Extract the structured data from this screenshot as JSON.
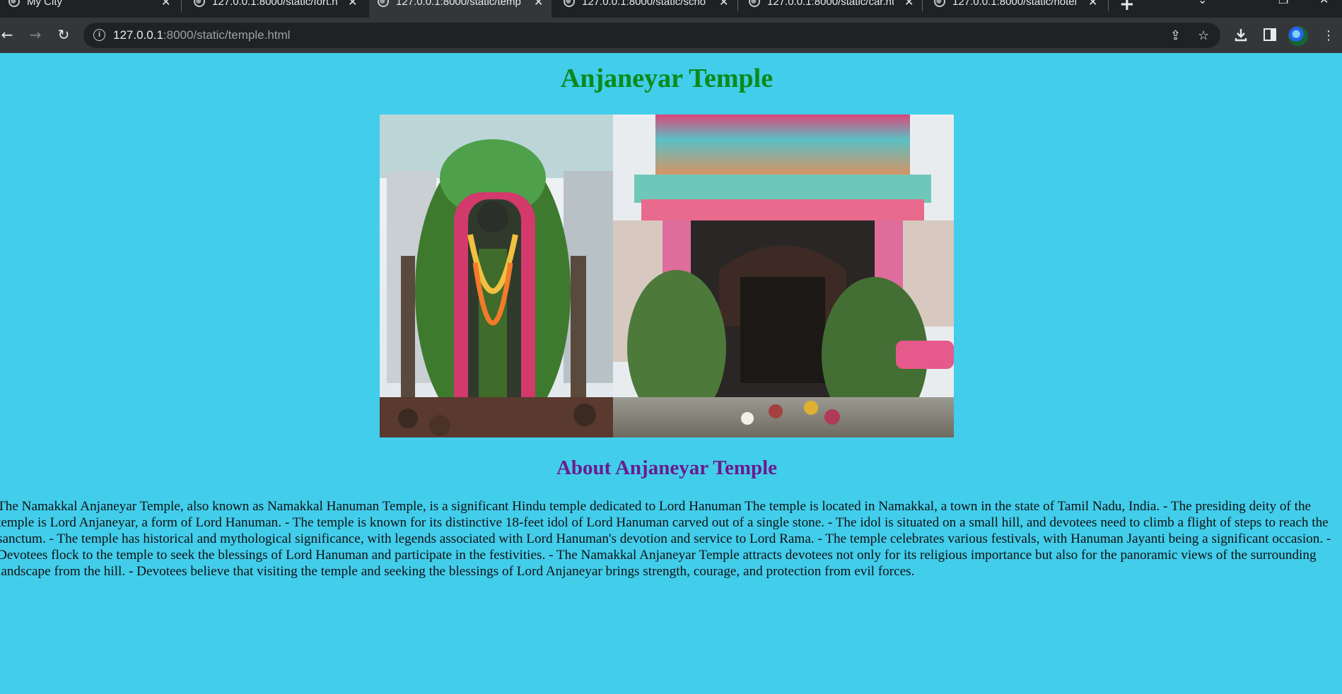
{
  "browser": {
    "tabs": [
      {
        "title": "My City",
        "active": false
      },
      {
        "title": "127.0.0.1:8000/static/fort.h",
        "active": false
      },
      {
        "title": "127.0.0.1:8000/static/temp",
        "active": true
      },
      {
        "title": "127.0.0.1:8000/static/scho",
        "active": false
      },
      {
        "title": "127.0.0.1:8000/static/car.ht",
        "active": false
      },
      {
        "title": "127.0.0.1:8000/static/hotel",
        "active": false
      }
    ],
    "url": {
      "host": "127.0.0.1",
      "rest": ":8000/static/temple.html"
    },
    "icons": {
      "back": "back-arrow-icon",
      "forward": "forward-arrow-icon",
      "reload": "reload-icon",
      "site_info": "info-icon",
      "share": "share-icon",
      "bookmark": "star-icon",
      "download": "download-icon",
      "side_panel": "side-panel-icon",
      "profile": "profile-avatar"
    }
  },
  "page": {
    "title": "Anjaneyar Temple",
    "about_heading": "About Anjaneyar Temple",
    "about_text": "The Namakkal Anjaneyar Temple, also known as Namakkal Hanuman Temple, is a significant Hindu temple dedicated to Lord Hanuman The temple is located in Namakkal, a town in the state of Tamil Nadu, India. - The presiding deity of the temple is Lord Anjaneyar, a form of Lord Hanuman. - The temple is known for its distinctive 18-feet idol of Lord Hanuman carved out of a single stone. - The idol is situated on a small hill, and devotees need to climb a flight of steps to reach the sanctum. - The temple has historical and mythological significance, with legends associated with Lord Hanuman's devotion and service to Lord Rama. - The temple celebrates various festivals, with Hanuman Jayanti being a significant occasion. - Devotees flock to the temple to seek the blessings of Lord Hanuman and participate in the festivities. - The Namakkal Anjaneyar Temple attracts devotees not only for its religious importance but also for the panoramic views of the surrounding landscape from the hill. - Devotees believe that visiting the temple and seeking the blessings of Lord Anjaneyar brings strength, courage, and protection from evil forces."
  },
  "colors": {
    "page_background": "#42cdeb",
    "title_color": "#0a8a1a",
    "heading_color": "#6a1b8e"
  }
}
